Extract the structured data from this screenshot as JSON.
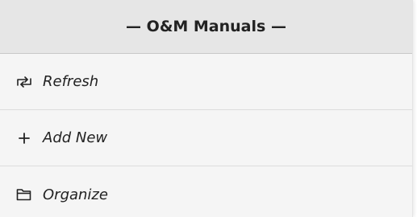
{
  "header": {
    "title": "— O&M Manuals —"
  },
  "menu": {
    "items": [
      {
        "label": "Refresh",
        "icon": "refresh-icon"
      },
      {
        "label": "Add New",
        "icon": "plus-icon"
      },
      {
        "label": "Organize",
        "icon": "folder-icon"
      }
    ]
  }
}
